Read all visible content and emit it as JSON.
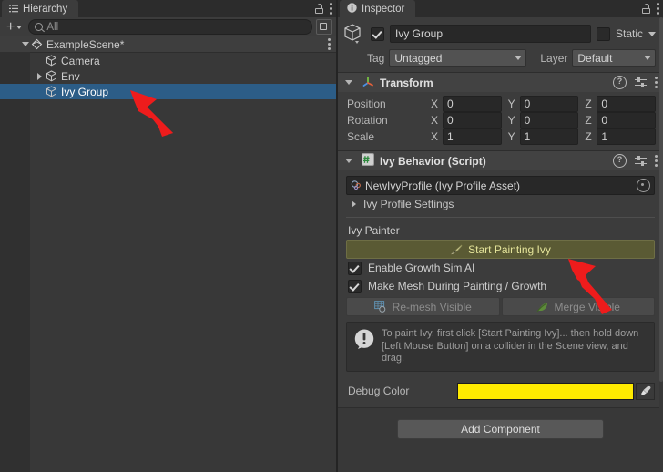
{
  "hierarchy": {
    "tab_label": "Hierarchy",
    "tab_icon": "hierarchy-icon",
    "lock_icon": "lock-icon",
    "menu_icon": "kebab-menu-icon",
    "add_label": "+",
    "search_placeholder": "All",
    "rows": [
      {
        "label": "ExampleScene*",
        "icon": "scene-icon",
        "depth": 0,
        "twisty": "open",
        "selected": false,
        "has_menu": true
      },
      {
        "label": "Camera",
        "icon": "gameobject-cube-icon",
        "depth": 1,
        "twisty": "none",
        "selected": false,
        "has_menu": false
      },
      {
        "label": "Env",
        "icon": "gameobject-cube-icon",
        "depth": 1,
        "twisty": "closed",
        "selected": false,
        "has_menu": false
      },
      {
        "label": "Ivy Group",
        "icon": "gameobject-cube-icon",
        "depth": 1,
        "twisty": "none",
        "selected": true,
        "has_menu": false
      }
    ]
  },
  "inspector": {
    "tab_label": "Inspector",
    "tab_icon": "info-icon",
    "lock_icon": "lock-icon",
    "menu_icon": "kebab-menu-icon",
    "object_header": {
      "enabled": true,
      "name": "Ivy Group",
      "static_label": "Static",
      "static_checked": false,
      "tag_label": "Tag",
      "tag_value": "Untagged",
      "layer_label": "Layer",
      "layer_value": "Default"
    },
    "transform": {
      "title": "Transform",
      "icon": "transform-axis-icon",
      "help_icon": "help-icon",
      "presets_icon": "presets-icon",
      "menu_icon": "kebab-menu-icon",
      "rows": [
        {
          "label": "Position",
          "x": "0",
          "y": "0",
          "z": "0"
        },
        {
          "label": "Rotation",
          "x": "0",
          "y": "0",
          "z": "0"
        },
        {
          "label": "Scale",
          "x": "1",
          "y": "1",
          "z": "1"
        }
      ],
      "axis_labels": [
        "X",
        "Y",
        "Z"
      ]
    },
    "ivy_behavior": {
      "title": "Ivy Behavior (Script)",
      "icon": "csharp-script-icon",
      "help_icon": "help-icon",
      "presets_icon": "presets-icon",
      "menu_icon": "kebab-menu-icon",
      "profile_field": {
        "value": "NewIvyProfile (Ivy Profile Asset)",
        "icon": "ivy-profile-asset-icon",
        "picker_icon": "object-picker-icon"
      },
      "profile_settings_label": "Ivy Profile Settings",
      "painter_section_label": "Ivy Painter",
      "start_painting_label": "Start Painting Ivy",
      "start_painting_icon": "paintbrush-icon",
      "checkboxes": [
        {
          "label": "Enable Growth Sim AI",
          "checked": true
        },
        {
          "label": "Make Mesh During Painting / Growth",
          "checked": true
        }
      ],
      "buttons": [
        {
          "label": "Re-mesh Visible",
          "icon": "remesh-icon",
          "disabled": true
        },
        {
          "label": "Merge Visible",
          "icon": "leaf-icon",
          "disabled": true
        }
      ],
      "help_box": {
        "icon": "info-exclamation-icon",
        "text": "To paint Ivy, first click [Start Painting Ivy]... then hold down [Left Mouse Button] on a collider in the Scene view, and drag."
      },
      "debug_color": {
        "label": "Debug Color",
        "value": "#FFEB00",
        "eyedropper_icon": "eyedropper-icon"
      }
    },
    "add_component_label": "Add Component"
  },
  "colors": {
    "panel_bg": "#383838",
    "header_bg": "#3c3c3c",
    "selection_blue": "#2c5d87",
    "paint_button_bg": "#5a5a34",
    "paint_button_text": "#e4e49a",
    "debug_color": "#FFEB00",
    "annotation_arrow": "#ee1c1c"
  },
  "annotations": [
    {
      "name": "arrow-pointing-to-ivy-group",
      "color": "#ee1c1c"
    },
    {
      "name": "arrow-pointing-to-start-painting-ivy",
      "color": "#ee1c1c"
    }
  ]
}
